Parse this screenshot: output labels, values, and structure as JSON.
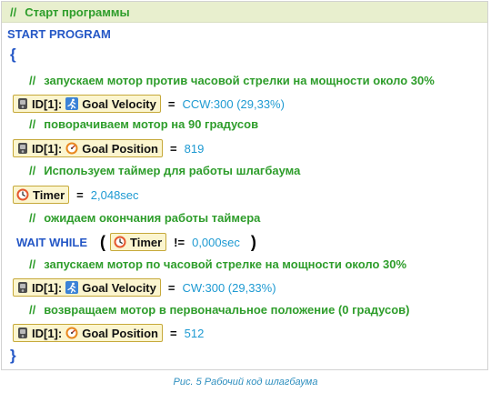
{
  "header": {
    "comment_mark": "//",
    "title": "Старт программы"
  },
  "program": {
    "start": "START PROGRAM",
    "open_brace": "{",
    "close_brace": "}",
    "comment_mark": "//",
    "comments": [
      "запускаем мотор против часовой стрелки на мощности около 30%",
      "поворачиваем мотор на 90 градусов",
      "Используем таймер для работы шлагбаума",
      "ожидаем окончания работы таймера",
      "запускаем мотор по часовой стрелке на мощности около 30%",
      "возвращаем мотор в первоначальное положение (0 градусов)"
    ],
    "statements": [
      {
        "id": "ID[1]:",
        "label": "Goal Velocity",
        "op": "=",
        "value": "CCW:300 (29,33%)"
      },
      {
        "id": "ID[1]:",
        "label": "Goal Position",
        "op": "=",
        "value": "819"
      },
      {
        "label": "Timer",
        "op": "=",
        "value": "2,048sec"
      },
      {
        "keyword": "WAIT WHILE",
        "open": "(",
        "label": "Timer",
        "op": "!=",
        "value": "0,000sec",
        "close": ")"
      },
      {
        "id": "ID[1]:",
        "label": "Goal Velocity",
        "op": "=",
        "value": "CW:300 (29,33%)"
      },
      {
        "id": "ID[1]:",
        "label": "Goal Position",
        "op": "=",
        "value": "512"
      }
    ]
  },
  "caption": "Рис. 5 Рабочий код шлагбаума",
  "colors": {
    "comment": "#2e9d2b",
    "keyword": "#2457c6",
    "value": "#1e9ad2",
    "block_fill": "#fbf5cf",
    "block_border": "#c6a93a",
    "header_fill": "#e8efce"
  },
  "icons": [
    "motor-icon",
    "velocity-runner-icon",
    "position-gauge-icon",
    "timer-icon"
  ]
}
